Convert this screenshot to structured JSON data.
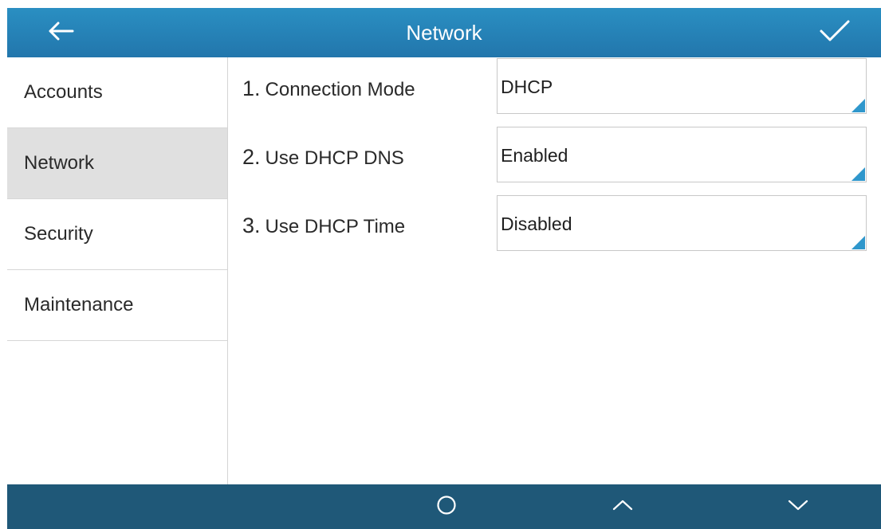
{
  "header": {
    "title": "Network",
    "back_icon": "arrow-left-icon",
    "confirm_icon": "checkmark-icon"
  },
  "sidebar": {
    "items": [
      {
        "label": "Accounts",
        "active": false
      },
      {
        "label": "Network",
        "active": true
      },
      {
        "label": "Security",
        "active": false
      },
      {
        "label": "Maintenance",
        "active": false
      }
    ]
  },
  "settings": [
    {
      "number": "1.",
      "label": "Connection Mode",
      "value": "DHCP"
    },
    {
      "number": "2.",
      "label": "Use DHCP DNS",
      "value": "Enabled"
    },
    {
      "number": "3.",
      "label": "Use DHCP Time",
      "value": "Disabled"
    }
  ],
  "bottom_bar": {
    "keys": [
      "circle-icon",
      "chevron-up-icon",
      "chevron-down-icon"
    ]
  },
  "colors": {
    "header": "#2580b6",
    "bottom_bar": "#1f5878",
    "active_item": "#e0e0e0",
    "accent": "#2f97cc"
  }
}
